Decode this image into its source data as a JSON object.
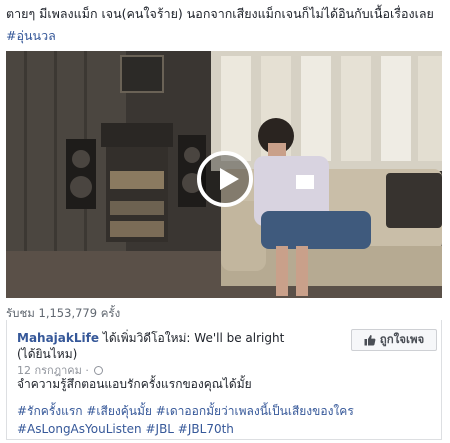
{
  "caption": {
    "text": "ตายๆ มีเพลงแม็ก เจน(คนใจร้าย) นอกจากเสียงแม็กเจนก็ไม่ได้อินกับเนื้อเรื่องเลย ",
    "hashtag": "#อุ่นนวล"
  },
  "video": {
    "views": "รับชม 1,153,779 ครั้ง"
  },
  "post": {
    "page_name": "MahajakLife",
    "action": " ได้เพิ่มวิดีโอใหม่: We'll be alright (ได้ยินไหม)",
    "date": "12 กรกฎาคม · ",
    "like_button_label": "ถูกใจเพจ",
    "message": "จำความรู้สึกตอนแอบรักครั้งแรกของคุณได้มั้ย",
    "hashtags_line1": "#รักครั้งแรก #เสียงคุ้นมั้ย #เดาออกมั้ยว่าเพลงนี้เป็นเสียงของใคร",
    "hashtags_line2": "#AsLongAsYouListen #JBL #JBL70th"
  },
  "colors": {
    "link": "#365899",
    "text": "#1d2129",
    "muted": "#90949c"
  },
  "icons": {
    "play": "play-icon",
    "globe": "globe-icon",
    "thumb": "thumbs-up-icon"
  }
}
